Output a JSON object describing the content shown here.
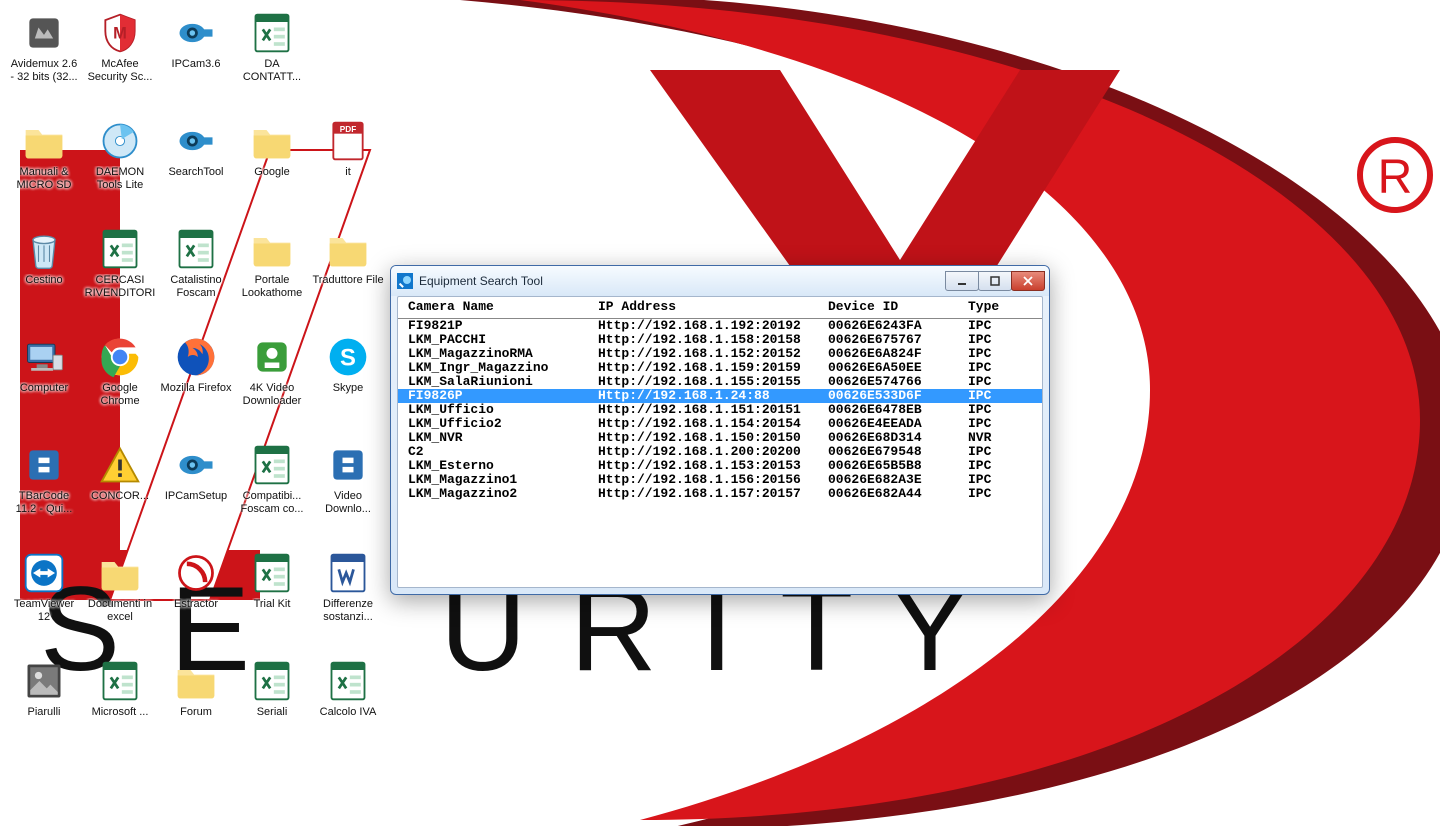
{
  "window": {
    "title": "Equipment Search Tool",
    "columns": {
      "name": "Camera Name",
      "ip": "IP Address",
      "device": "Device ID",
      "type": "Type"
    },
    "rows": [
      {
        "name": "FI9821P",
        "ip": "Http://192.168.1.192:20192",
        "device": "00626E6243FA",
        "type": "IPC",
        "selected": false
      },
      {
        "name": "LKM_PACCHI",
        "ip": "Http://192.168.1.158:20158",
        "device": "00626E675767",
        "type": "IPC",
        "selected": false
      },
      {
        "name": "LKM_MagazzinoRMA",
        "ip": "Http://192.168.1.152:20152",
        "device": "00626E6A824F",
        "type": "IPC",
        "selected": false
      },
      {
        "name": "LKM_Ingr_Magazzino",
        "ip": "Http://192.168.1.159:20159",
        "device": "00626E6A50EE",
        "type": "IPC",
        "selected": false
      },
      {
        "name": "LKM_SalaRiunioni",
        "ip": "Http://192.168.1.155:20155",
        "device": "00626E574766",
        "type": "IPC",
        "selected": false
      },
      {
        "name": "FI9826P",
        "ip": "Http://192.168.1.24:88",
        "device": "00626E533D6F",
        "type": "IPC",
        "selected": true
      },
      {
        "name": "LKM_Ufficio",
        "ip": "Http://192.168.1.151:20151",
        "device": "00626E6478EB",
        "type": "IPC",
        "selected": false
      },
      {
        "name": "LKM_Ufficio2",
        "ip": "Http://192.168.1.154:20154",
        "device": "00626E4EEADA",
        "type": "IPC",
        "selected": false
      },
      {
        "name": "LKM_NVR",
        "ip": "Http://192.168.1.150:20150",
        "device": "00626E68D314",
        "type": "NVR",
        "selected": false
      },
      {
        "name": "C2",
        "ip": "Http://192.168.1.200:20200",
        "device": "00626E679548",
        "type": "IPC",
        "selected": false
      },
      {
        "name": "LKM_Esterno",
        "ip": "Http://192.168.1.153:20153",
        "device": "00626E65B5B8",
        "type": "IPC",
        "selected": false
      },
      {
        "name": "LKM_Magazzino1",
        "ip": "Http://192.168.1.156:20156",
        "device": "00626E682A3E",
        "type": "IPC",
        "selected": false
      },
      {
        "name": "LKM_Magazzino2",
        "ip": "Http://192.168.1.157:20157",
        "device": "00626E682A44",
        "type": "IPC",
        "selected": false
      }
    ]
  },
  "wallpaper": {
    "word_letters": [
      "U",
      "R",
      "I",
      "T",
      "Y"
    ],
    "registered_mark": "®"
  },
  "icons": [
    {
      "name": "avidemux-icon",
      "kind": "app-generic",
      "label": "Avidemux 2.6 - 32 bits (32..."
    },
    {
      "name": "mcafee-icon",
      "kind": "shield",
      "label": "McAfee Security Sc..."
    },
    {
      "name": "ipcam36-icon",
      "kind": "camera",
      "label": "IPCam3.6"
    },
    {
      "name": "da-contatt-icon",
      "kind": "excel",
      "label": "DA CONTATT..."
    },
    {
      "name": "spacer-1",
      "kind": "",
      "label": ""
    },
    {
      "name": "manuali-sd-icon",
      "kind": "folder",
      "label": "Manuali & MICRO SD"
    },
    {
      "name": "daemon-tools-icon",
      "kind": "disc",
      "label": "DAEMON Tools Lite"
    },
    {
      "name": "search-tool-icon",
      "kind": "camera",
      "label": "SearchTool"
    },
    {
      "name": "google-folder-icon",
      "kind": "folder",
      "label": "Google"
    },
    {
      "name": "it-icon",
      "kind": "pdf",
      "label": "it"
    },
    {
      "name": "cestino-icon",
      "kind": "trash",
      "label": "Cestino"
    },
    {
      "name": "cercasi-riv-icon",
      "kind": "excel",
      "label": "CERCASI RIVENDITORI"
    },
    {
      "name": "catalistino-icon",
      "kind": "excel",
      "label": "Catalistino Foscam"
    },
    {
      "name": "portale-look-icon",
      "kind": "folder",
      "label": "Portale Lookathome"
    },
    {
      "name": "traduttore-file-icon",
      "kind": "folder",
      "label": "Traduttore File"
    },
    {
      "name": "computer-icon",
      "kind": "computer",
      "label": "Computer"
    },
    {
      "name": "chrome-icon",
      "kind": "chrome",
      "label": "Google Chrome"
    },
    {
      "name": "firefox-icon",
      "kind": "firefox",
      "label": "Mozilla Firefox"
    },
    {
      "name": "4kvideo-icon",
      "kind": "app-green",
      "label": "4K Video Downloader"
    },
    {
      "name": "skype-icon",
      "kind": "skype",
      "label": "Skype"
    },
    {
      "name": "tbarcode-icon",
      "kind": "app-blue",
      "label": "TBarCode 11.2 - Qui..."
    },
    {
      "name": "concor-icon",
      "kind": "warning",
      "label": "CONCOR..."
    },
    {
      "name": "ipcamsetup-icon",
      "kind": "camera",
      "label": "IPCamSetup"
    },
    {
      "name": "compatibi-icon",
      "kind": "excel",
      "label": "Compatibi... Foscam co..."
    },
    {
      "name": "video-downlo-icon",
      "kind": "app-blue",
      "label": "Video Downlo..."
    },
    {
      "name": "teamviewer-icon",
      "kind": "teamviewer",
      "label": "TeamViewer 12"
    },
    {
      "name": "documenti-excel-icon",
      "kind": "folder",
      "label": "Documenti in excel"
    },
    {
      "name": "estractor-icon",
      "kind": "app-red",
      "label": "Estractor"
    },
    {
      "name": "trial-kit-icon",
      "kind": "excel",
      "label": "Trial Kit"
    },
    {
      "name": "differenze-icon",
      "kind": "word",
      "label": "Differenze sostanzi..."
    },
    {
      "name": "piarulli-icon",
      "kind": "image",
      "label": "Piarulli"
    },
    {
      "name": "microsoft-icon",
      "kind": "excel",
      "label": "Microsoft ..."
    },
    {
      "name": "forum-icon",
      "kind": "folder",
      "label": "Forum"
    },
    {
      "name": "seriali-icon",
      "kind": "excel",
      "label": "Seriali"
    },
    {
      "name": "calcolo-iva-icon",
      "kind": "excel",
      "label": "Calcolo IVA"
    }
  ]
}
